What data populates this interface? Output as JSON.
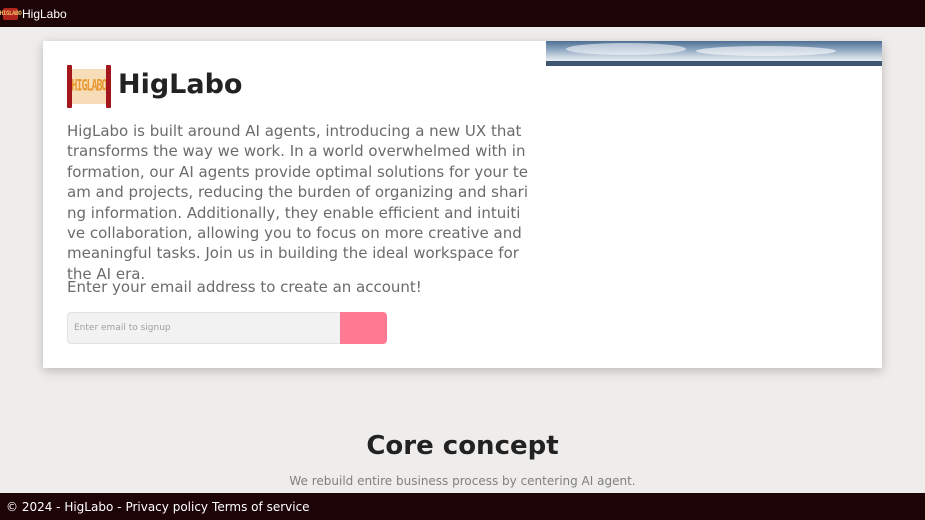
{
  "topbar": {
    "brand_icon": "higlabo-logo-icon",
    "brand_label": "HigLabo"
  },
  "hero": {
    "logo_text": "HIGLABO",
    "title": "HigLabo",
    "description": "HigLabo is built around AI agents, introducing a new UX that transforms the way we work. In a world overwhelmed with information, our AI agents provide optimal solutions for your team and projects, reducing the burden of organizing and sharing information. Additionally, they enable efficient and intuitive collaboration, allowing you to focus on more creative and meaningful tasks. Join us in building the ideal workspace for the AI era.",
    "signup_prompt": "Enter your email address to create an account!",
    "email_placeholder": "Enter email to signup",
    "email_value": "",
    "submit_label": "",
    "accent_color": "#fe7a92"
  },
  "core": {
    "title": "Core concept",
    "subtitle": "We rebuild entire business process by centering AI agent."
  },
  "footer": {
    "copyright": "© 2024 - HigLabo -",
    "privacy_label": "Privacy policy",
    "terms_label": "Terms of service"
  },
  "colors": {
    "bar_background": "#1c0407",
    "page_background": "#efedeb",
    "brand_red": "#a3161b"
  }
}
